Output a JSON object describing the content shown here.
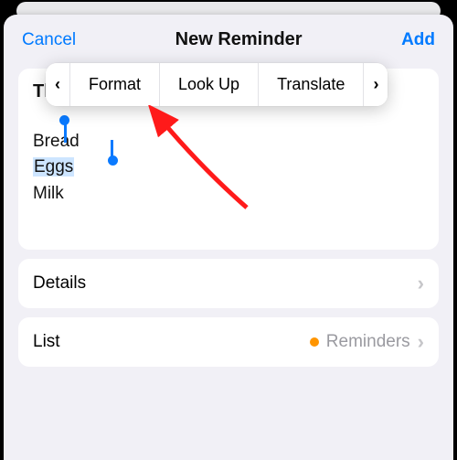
{
  "nav": {
    "cancel": "Cancel",
    "title": "New Reminder",
    "add": "Add"
  },
  "note": {
    "title": "Things to buy",
    "lines": [
      "Bread",
      "Eggs",
      "Milk"
    ],
    "selected_line_index": 1
  },
  "popup": {
    "prev": "‹",
    "items": [
      "Format",
      "Look Up",
      "Translate"
    ],
    "next": "›"
  },
  "rows": {
    "details_label": "Details",
    "list_label": "List",
    "list_value": "Reminders",
    "list_dot_color": "#ff9500",
    "chevron": "›"
  }
}
